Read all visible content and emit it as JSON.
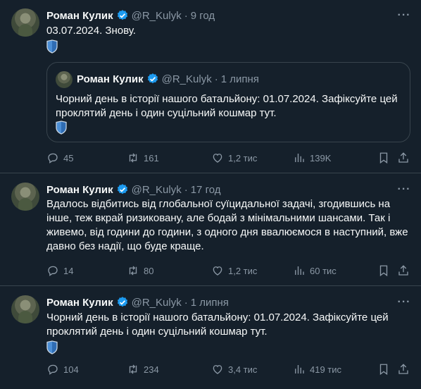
{
  "tweets": [
    {
      "author": "Роман Кулик",
      "handle": "@R_Kulyk",
      "dot": "·",
      "time": "9 год",
      "text": "03.07.2024. Знову.",
      "quote": {
        "author": "Роман Кулик",
        "handle": "@R_Kulyk",
        "dot": "·",
        "time": "1 липня",
        "text": "Чорний день в історії нашого батальйону: 01.07.2024. Зафіксуйте цей проклятий день і один суцільний кошмар тут."
      },
      "replies": "45",
      "retweets": "161",
      "likes": "1,2 тис",
      "views": "139K"
    },
    {
      "author": "Роман Кулик",
      "handle": "@R_Kulyk",
      "dot": "·",
      "time": "17 год",
      "text": "Вдалось відбитись від глобальної суїцидальної задачі, згодившись на інше, теж вкрай ризиковану, але бодай з мінімальними шансами. Так і живемо, від години до години, з одного дня ввалюємося в наступний, вже давно без надії, що буде краще.",
      "replies": "14",
      "retweets": "80",
      "likes": "1,2 тис",
      "views": "60 тис"
    },
    {
      "author": "Роман Кулик",
      "handle": "@R_Kulyk",
      "dot": "·",
      "time": "1 липня",
      "text": "Чорний день в історії нашого батальйону: 01.07.2024. Зафіксуйте цей проклятий день і один суцільний кошмар тут.",
      "replies": "104",
      "retweets": "234",
      "likes": "3,4 тис",
      "views": "419 тис"
    }
  ],
  "icons": {
    "verified": "verified-badge-icon",
    "shield": "shield-icon",
    "more": "more-icon",
    "reply": "reply-icon",
    "retweet": "retweet-icon",
    "like": "like-icon",
    "views": "views-icon",
    "bookmark": "bookmark-icon",
    "share": "share-icon"
  },
  "colors": {
    "background": "#15202b",
    "border": "#38444d",
    "secondary_text": "#8b98a5",
    "verified": "#1d9bf0"
  }
}
